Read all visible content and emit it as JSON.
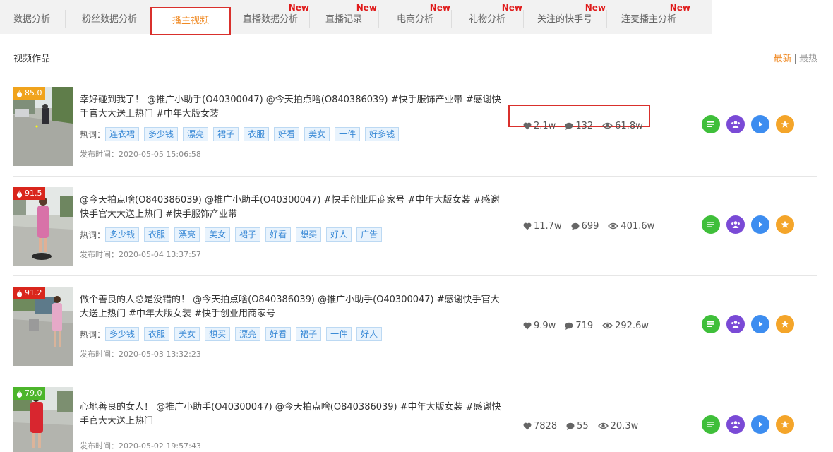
{
  "tabs": [
    {
      "label": "数据分析",
      "new": ""
    },
    {
      "label": "粉丝数据分析",
      "new": ""
    },
    {
      "label": "播主视频",
      "new": ""
    },
    {
      "label": "直播数据分析",
      "new": "New"
    },
    {
      "label": "直播记录",
      "new": "New"
    },
    {
      "label": "电商分析",
      "new": "New"
    },
    {
      "label": "礼物分析",
      "new": "New"
    },
    {
      "label": "关注的快手号",
      "new": "New"
    },
    {
      "label": "连麦播主分析",
      "new": "New"
    }
  ],
  "section": {
    "title": "视频作品",
    "sort_latest": "最新",
    "sort_sep": "|",
    "sort_hot": "最热"
  },
  "labels": {
    "hot_words": "热词：",
    "publish_prefix": "发布时间："
  },
  "colors": {
    "accent": "#f08a24",
    "highlight_border": "#d9302c",
    "tag_text": "#3a8ad6"
  },
  "videos": [
    {
      "score": "85.0",
      "score_color": "orange",
      "title": "幸好碰到我了！ @推广小助手(O40300047) @今天拍点啥(O840386039) #快手服饰产业带 #感谢快手官大大送上热门 #中年大版女装",
      "tags": [
        "连衣裙",
        "多少钱",
        "漂亮",
        "裙子",
        "衣服",
        "好看",
        "美女",
        "一件",
        "好多钱"
      ],
      "time": "2020-05-05 15:06:58",
      "likes": "2.1w",
      "comments": "132",
      "views": "61.8w"
    },
    {
      "score": "91.5",
      "score_color": "red",
      "title": "@今天拍点啥(O840386039) @推广小助手(O40300047) #快手创业用商家号 #中年大版女装 #感谢快手官大大送上热门 #快手服饰产业带",
      "tags": [
        "多少钱",
        "衣服",
        "漂亮",
        "美女",
        "裙子",
        "好看",
        "想买",
        "好人",
        "广告"
      ],
      "time": "2020-05-04 13:37:57",
      "likes": "11.7w",
      "comments": "699",
      "views": "401.6w"
    },
    {
      "score": "91.2",
      "score_color": "red",
      "title": "做个善良的人总是没错的！ @今天拍点啥(O840386039) @推广小助手(O40300047) #感谢快手官大大送上热门 #中年大版女装 #快手创业用商家号",
      "tags": [
        "多少钱",
        "衣服",
        "美女",
        "想买",
        "漂亮",
        "好看",
        "裙子",
        "一件",
        "好人"
      ],
      "time": "2020-05-03 13:32:23",
      "likes": "9.9w",
      "comments": "719",
      "views": "292.6w"
    },
    {
      "score": "79.0",
      "score_color": "green",
      "title": "心地善良的女人！ @推广小助手(O40300047) @今天拍点啥(O840386039) #中年大版女装 #感谢快手官大大送上热门",
      "tags": [],
      "time": "2020-05-02 19:57:43",
      "likes": "7828",
      "comments": "55",
      "views": "20.3w"
    }
  ]
}
